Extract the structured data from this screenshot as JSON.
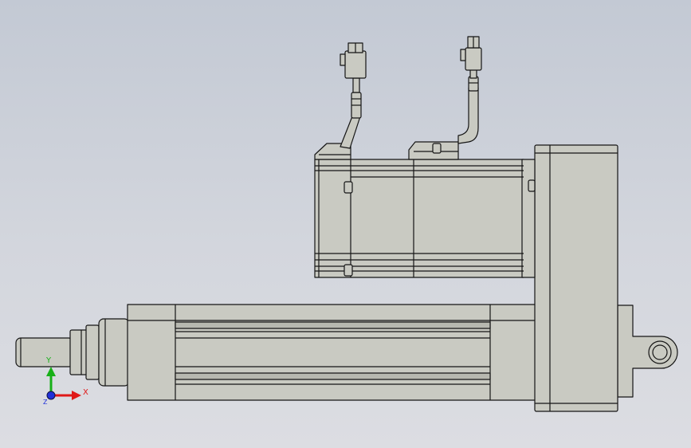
{
  "viewport": {
    "background_top": "#c3c9d4",
    "background_bottom": "#dcdde2"
  },
  "model": {
    "part_fill": "#c9cac2",
    "part_fill_dark": "#b7b8b0",
    "edge_color": "#151515"
  },
  "triad": {
    "x_label": "X",
    "y_label": "Y",
    "z_label": "Z",
    "x_color": "#e01818",
    "y_color": "#18b018",
    "z_color": "#2030d8"
  }
}
